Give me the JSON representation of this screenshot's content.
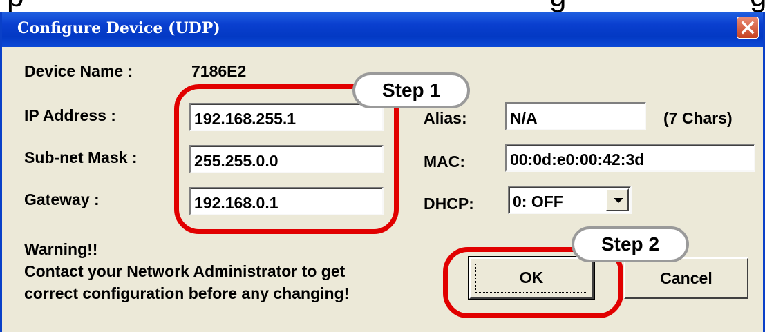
{
  "window": {
    "title": "Configure Device (UDP)",
    "close_icon": "close-icon"
  },
  "labels": {
    "device_name": "Device Name :",
    "ip_address": "IP Address :",
    "subnet_mask": "Sub-net Mask :",
    "gateway": "Gateway :",
    "alias": "Alias:",
    "mac": "MAC:",
    "dhcp": "DHCP:",
    "alias_hint": "(7 Chars)"
  },
  "values": {
    "device_name": "7186E2",
    "ip_address": "192.168.255.1",
    "subnet_mask": "255.255.0.0",
    "gateway": "192.168.0.1",
    "alias": "N/A",
    "mac": "00:0d:e0:00:42:3d",
    "dhcp": "0: OFF"
  },
  "warning": {
    "line1": "Warning!!",
    "line2": "Contact your Network Administrator to get",
    "line3": "correct  configuration before any changing!"
  },
  "buttons": {
    "ok": "OK",
    "cancel": "Cancel"
  },
  "annotations": {
    "step1": "Step 1",
    "step2": "Step 2"
  },
  "colors": {
    "highlight": "#e10000",
    "titlebar": "#0a3fcf",
    "dialog_bg": "#ece9d8"
  }
}
